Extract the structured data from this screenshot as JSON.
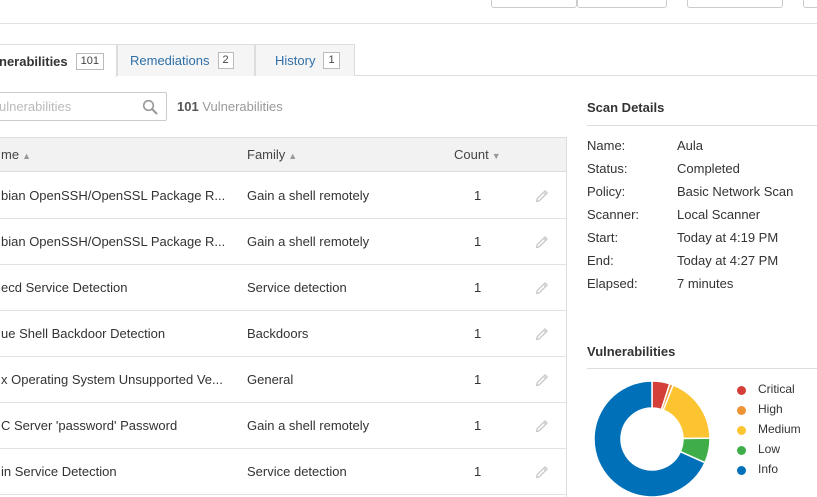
{
  "tabs": [
    {
      "label": "nerabilities",
      "count": "101"
    },
    {
      "label": "Remediations",
      "count": "2"
    },
    {
      "label": "History",
      "count": "1"
    }
  ],
  "search": {
    "placeholder": "ulnerabilities",
    "icon": "search-icon"
  },
  "vuln_count": {
    "number": "101",
    "label": "Vulnerabilities"
  },
  "table": {
    "columns": {
      "name": "me",
      "family": "Family",
      "count": "Count"
    },
    "rows": [
      {
        "name": "bian OpenSSH/OpenSSL Package R...",
        "family": "Gain a shell remotely",
        "count": "1"
      },
      {
        "name": "bian OpenSSH/OpenSSL Package R...",
        "family": "Gain a shell remotely",
        "count": "1"
      },
      {
        "name": "ecd Service Detection",
        "family": "Service detection",
        "count": "1"
      },
      {
        "name": "ue Shell Backdoor Detection",
        "family": "Backdoors",
        "count": "1"
      },
      {
        "name": "x Operating System Unsupported Ve...",
        "family": "General",
        "count": "1"
      },
      {
        "name": "C Server 'password' Password",
        "family": "Gain a shell remotely",
        "count": "1"
      },
      {
        "name": "in Service Detection",
        "family": "Service detection",
        "count": "1"
      }
    ]
  },
  "scan_details": {
    "title": "Scan Details",
    "items": [
      {
        "label": "Name:",
        "value": "Aula"
      },
      {
        "label": "Status:",
        "value": "Completed"
      },
      {
        "label": "Policy:",
        "value": "Basic Network Scan"
      },
      {
        "label": "Scanner:",
        "value": "Local Scanner"
      },
      {
        "label": "Start:",
        "value": "Today at 4:19 PM"
      },
      {
        "label": "End:",
        "value": "Today at 4:27 PM"
      },
      {
        "label": "Elapsed:",
        "value": "7 minutes"
      }
    ]
  },
  "vulnerabilities_panel": {
    "title": "Vulnerabilities",
    "legend": [
      {
        "label": "Critical",
        "color": "#d43f3a",
        "value": 5
      },
      {
        "label": "High",
        "color": "#ee9336",
        "value": 1
      },
      {
        "label": "Medium",
        "color": "#fdc431",
        "value": 19
      },
      {
        "label": "Low",
        "color": "#3fae49",
        "value": 7
      },
      {
        "label": "Info",
        "color": "#0071b9",
        "value": 69
      }
    ]
  }
}
